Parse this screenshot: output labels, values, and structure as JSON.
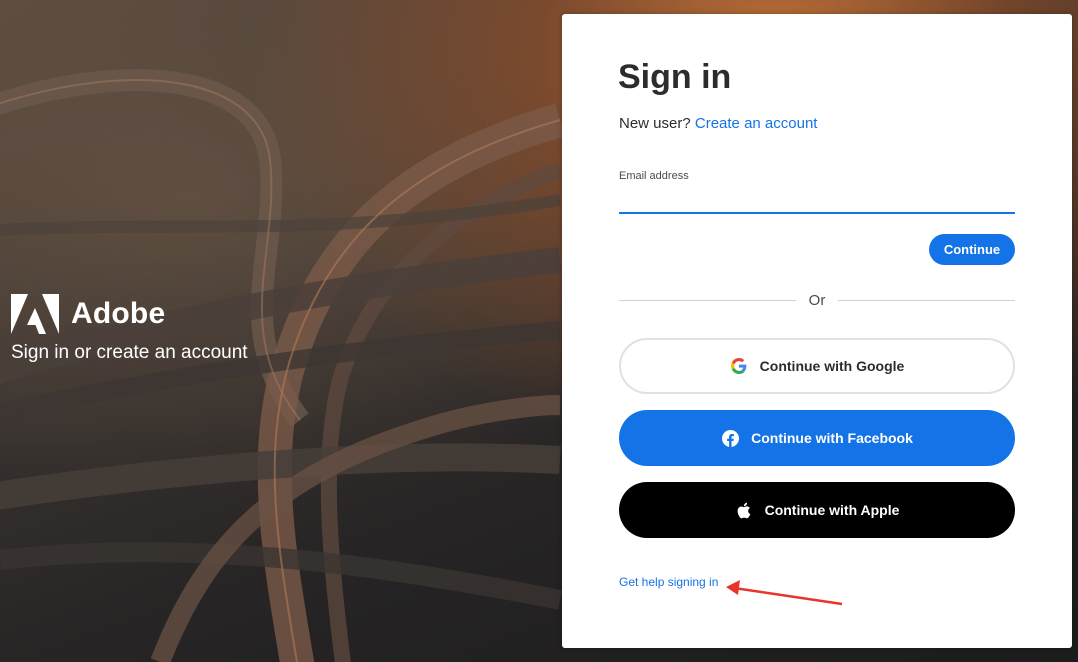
{
  "brand": {
    "name": "Adobe",
    "tagline": "Sign in or create an account"
  },
  "signin": {
    "title": "Sign in",
    "new_user_prompt": "New user?",
    "create_account_link": "Create an account",
    "email_label": "Email address",
    "email_value": "",
    "continue_label": "Continue",
    "divider_text": "Or",
    "google_label": "Continue with Google",
    "facebook_label": "Continue with Facebook",
    "apple_label": "Continue with Apple",
    "help_link": "Get help signing in"
  },
  "colors": {
    "accent": "#1473e6",
    "facebook": "#1473e6",
    "apple": "#000000",
    "annotation_arrow": "#e8342a"
  }
}
